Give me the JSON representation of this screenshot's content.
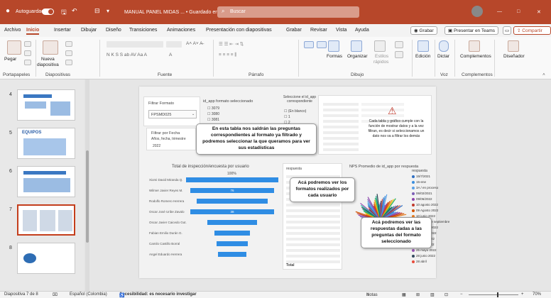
{
  "titlebar": {
    "autosave": "Autoguardado",
    "doc_title": "MANUAL PANEL MIDAS ... • Guardado en Este PC ∨",
    "search_placeholder": "Buscar",
    "minimize_glyph": "—",
    "maximize_glyph": "□",
    "close_glyph": "✕"
  },
  "menu": {
    "tabs": [
      "Archivo",
      "Inicio",
      "Insertar",
      "Dibujar",
      "Diseño",
      "Transiciones",
      "Animaciones",
      "Presentación con diapositivas",
      "Grabar",
      "Revisar",
      "Vista",
      "Ayuda"
    ],
    "grabar_btn": "Grabar",
    "teams_btn": "Presentar en Teams",
    "share_btn": "Compartir"
  },
  "ribbon": {
    "pegar": "Pegar",
    "nueva": "Nueva",
    "diapositiva": "diapositiva",
    "formas": "Formas",
    "organizar": "Organizar",
    "estilos": "Estilos",
    "rapidos": "rápidos",
    "edicion": "Edición",
    "dictar": "Dictar",
    "complementos": "Complementos",
    "disenador": "Diseñador",
    "groups": {
      "portapapeles": "Portapapeles",
      "diapositivas": "Diapositivas",
      "fuente": "Fuente",
      "parrafo": "Párrafo",
      "dibujo": "Dibujo",
      "voz": "Voz",
      "complementos": "Complementos"
    }
  },
  "thumbnails": [
    {
      "num": "4"
    },
    {
      "num": "5",
      "label": "EQUIPOS"
    },
    {
      "num": "6"
    },
    {
      "num": "7"
    },
    {
      "num": "8"
    }
  ],
  "slide": {
    "filter_label": "Filtrar Formato",
    "filter_value": "FPSMD025",
    "date_filter_label": "Filtrar por Fecha",
    "date_sub": "Años, fecha, trimestre",
    "date_year": "2022",
    "idapp_title": "id_app formato seleccionado",
    "idapp_items": [
      "3079",
      "3080",
      "3081"
    ],
    "select_title": "Seleccione el id_app correspondiente",
    "select_items": [
      "(En blanco)",
      "1",
      "2"
    ],
    "funnel_title": "Total de inspección/encuesta por usuario",
    "funnel_pct": "100%",
    "funnel_labels": [
      "Xiomi David Miranda Q.",
      "Wilmer Javier Reyes M.",
      "Rodolfo Romero Herrera",
      "Oscar José Uribe Zavalo",
      "Oscar Javier Caicedo Gut.",
      "Fabian Emilio Durán G.",
      "Camilo Castillo Borral",
      "Angel Eduardo Herrera"
    ],
    "funnel_values": [
      "",
      "76",
      "",
      "38",
      "",
      "",
      "",
      ""
    ],
    "respuesta_title": "respuesta",
    "nps_title": "NPS Promedio de id_app por respuesta",
    "legend_title": "respuesta",
    "legend_items": [
      "15/7/2021",
      "15-ene",
      "3A / en proceso",
      "06/02/2021",
      "09/06/2022",
      "10 agosto 2022",
      "09 Agosto 2022",
      "10 junio 2022",
      "1 / 8 / 21 de septiembre",
      "24 agosto 2022",
      "20 mayo 2022",
      "23 abril 2022",
      "22 julio 2022",
      "25 mayo 2022",
      "28 junio 2022",
      "28 abril"
    ],
    "legend_colors": [
      "#2f6fc2",
      "#3b8ede",
      "#5aa0e6",
      "#7d5fb5",
      "#8e44ad",
      "#c0392b",
      "#d35400",
      "#e67e22",
      "#f1c40f",
      "#27ae60",
      "#16a085",
      "#2c3e50",
      "#1abc9c",
      "#9b59b6",
      "#34495e",
      "#e74c3c"
    ],
    "alert_text": "Cada tabla y gráfico cumple con la función de mostrar datos y a la vez filtran, es decir si seleccionamos un dato nos va a filtrar los demás",
    "callout1": "En esta tabla nos saldrán las preguntas correspondientes al formato ya filtrado y podremos seleccionar la que queramos para ver sus estadísticas",
    "callout2": "Acá podremos ver los formatos realizados por cada usuario",
    "callout3": "Acá podremos ver las respuestas dadas a las preguntas del formato seleccionado",
    "list_total": "Total"
  },
  "statusbar": {
    "slide_info": "Diapositiva 7 de 8",
    "language": "Español (Colombia)",
    "accessibility": "Accesibilidad: es necesario investigar",
    "notes": "Notas",
    "zoom": "70%"
  },
  "colors": {
    "accent": "#b7472a",
    "funnel_bar": "#2f8de4",
    "alert": "#c0392b"
  }
}
